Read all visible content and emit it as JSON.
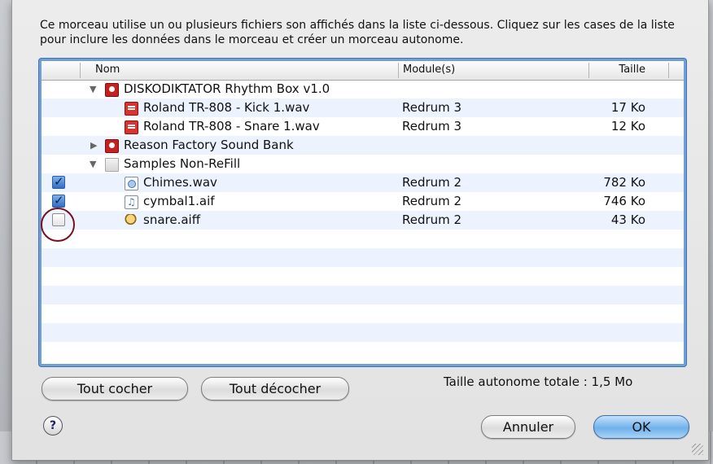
{
  "dialog": {
    "message": "Ce morceau utilise un ou plusieurs fichiers son affichés dans la liste ci-dessous. Cliquez sur les cases de la liste pour inclure les données dans le morceau et créer un morceau autonome."
  },
  "table": {
    "columns": {
      "name": "Nom",
      "module": "Module(s)",
      "size": "Taille"
    },
    "rows": [
      {
        "name": "DISKODIKTATOR Rhythm Box v1.0",
        "module": "",
        "size": "",
        "icon": "reason-device-icon",
        "disclosure": "expanded"
      },
      {
        "name": "Roland TR-808 - Kick 1.wav",
        "module": "Redrum 3",
        "size": "17 Ko",
        "icon": "sample-file-icon"
      },
      {
        "name": "Roland TR-808 - Snare 1.wav",
        "module": "Redrum 3",
        "size": "12 Ko",
        "icon": "sample-file-icon"
      },
      {
        "name": "Reason Factory Sound Bank",
        "module": "",
        "size": "",
        "icon": "reason-device-icon",
        "disclosure": "collapsed"
      },
      {
        "name": "Samples Non-ReFill",
        "module": "",
        "size": "",
        "icon": "folder-icon",
        "disclosure": "expanded"
      },
      {
        "name": "Chimes.wav",
        "module": "Redrum 2",
        "size": "782 Ko",
        "icon": "wav-file-icon",
        "checked": true
      },
      {
        "name": "cymbal1.aif",
        "module": "Redrum 2",
        "size": "746 Ko",
        "icon": "aif-file-icon",
        "checked": true
      },
      {
        "name": "snare.aiff",
        "module": "Redrum 2",
        "size": "43 Ko",
        "icon": "aiff-file-icon",
        "checked": false
      }
    ]
  },
  "buttons": {
    "check_all": "Tout cocher",
    "uncheck_all": "Tout décocher",
    "cancel": "Annuler",
    "ok": "OK",
    "help": "?"
  },
  "total_label": "Taille autonome totale : 1,5 Mo",
  "colors": {
    "selection_frame": "#6f9fd6",
    "alt_row": "#edf3fe",
    "device_icon": "#c8201e",
    "highlight_circle": "#7a0f1d"
  }
}
